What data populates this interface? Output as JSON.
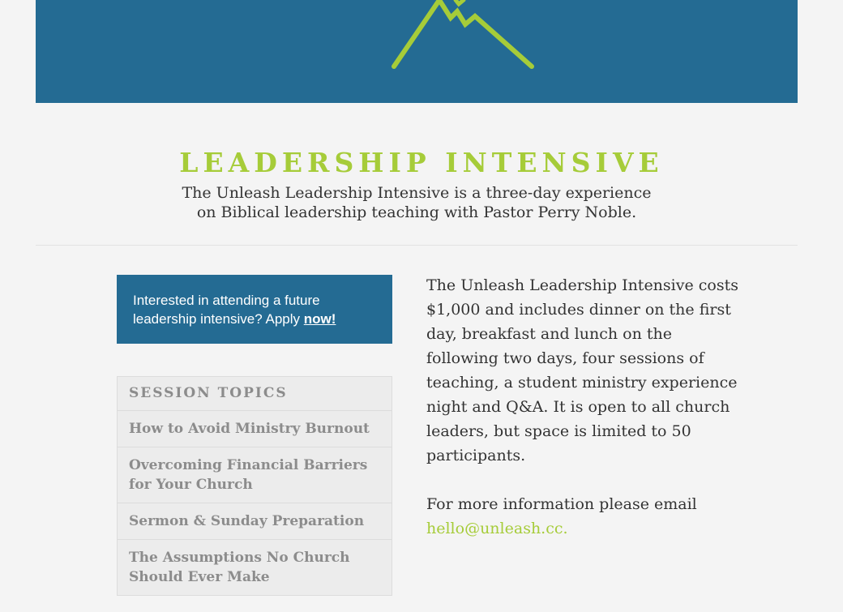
{
  "header": {
    "logo": "mountain-logo-icon",
    "colors": {
      "banner": "#246b93",
      "accent": "#a6cc39"
    }
  },
  "intro": {
    "title": "LEADERSHIP INTENSIVE",
    "subtitle_line1": "The Unleash Leadership Intensive is a three-day experience",
    "subtitle_line2": "on Biblical leadership teaching with Pastor Perry Noble."
  },
  "apply": {
    "text": "Interested in attending a future leadership intensive? Apply ",
    "link": "now!"
  },
  "topics": {
    "heading": "SESSION TOPICS",
    "items": [
      "How to Avoid Ministry Burnout",
      "Overcoming Financial Barriers for Your Church",
      "Sermon & Sunday Preparation",
      "The Assumptions No Church Should Ever Make"
    ]
  },
  "details": {
    "paragraph": "The Unleash Leadership Intensive costs $1,000 and includes dinner on the first day, breakfast and lunch on the following two days, four sessions of teaching, a student ministry experience night and Q&A. It is open to all church leaders, but space is limited to 50 participants.",
    "contact_text": "For more information please email ",
    "email": "hello@unleash.cc."
  }
}
